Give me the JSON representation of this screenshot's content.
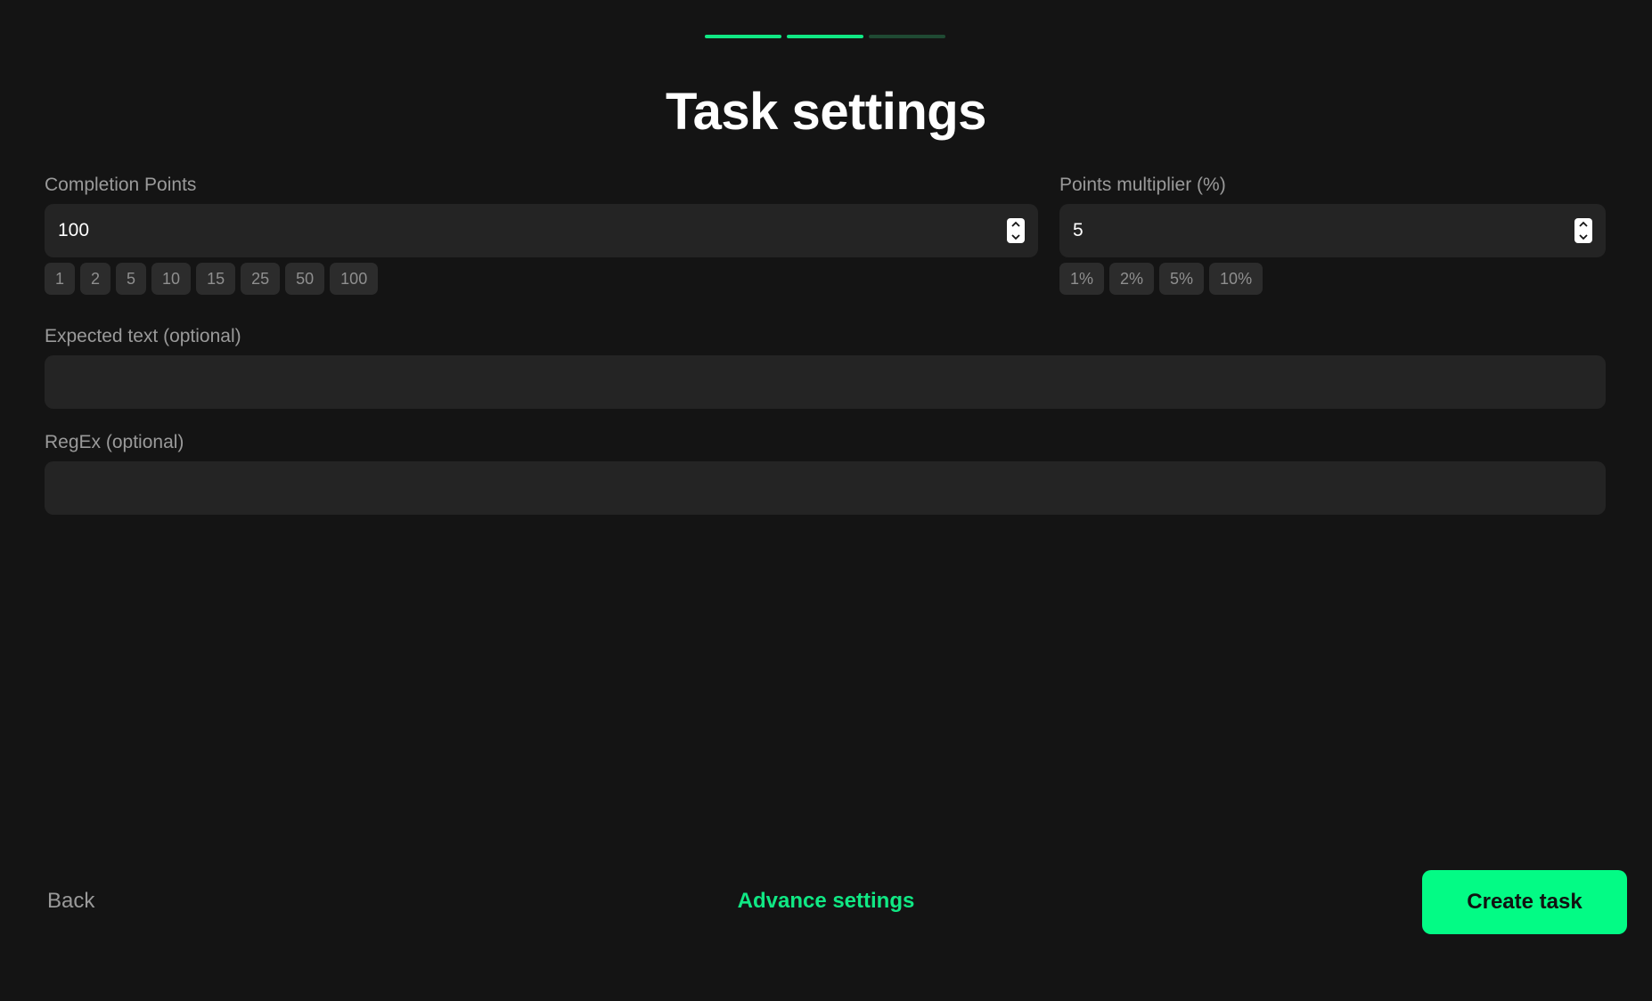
{
  "progress": {
    "steps_total": 3,
    "steps_completed": 2
  },
  "header": {
    "title": "Task settings"
  },
  "completion_points": {
    "label": "Completion Points",
    "value": "100",
    "presets": [
      "1",
      "2",
      "5",
      "10",
      "15",
      "25",
      "50",
      "100"
    ]
  },
  "points_multiplier": {
    "label": "Points multiplier (%)",
    "value": "5",
    "presets": [
      "1%",
      "2%",
      "5%",
      "10%"
    ]
  },
  "expected_text": {
    "label": "Expected text (optional)",
    "value": ""
  },
  "regex": {
    "label": "RegEx (optional)",
    "value": ""
  },
  "footer": {
    "back_label": "Back",
    "advanced_label": "Advance settings",
    "create_label": "Create task"
  },
  "colors": {
    "background": "#141414",
    "accent": "#03fb85",
    "accent_text": "#10e884",
    "input_bg": "#242424",
    "chip_bg": "#2c2c2c",
    "muted_text": "#9a9a9a"
  },
  "icons": {
    "spinner": "number-stepper-icon"
  }
}
